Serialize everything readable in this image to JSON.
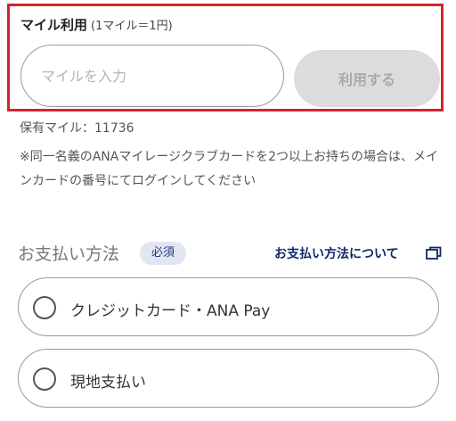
{
  "mileage": {
    "title": "マイル利用",
    "rate": "(1マイル＝1円)",
    "input_placeholder": "マイルを入力",
    "input_value": "",
    "use_button_label": "利用する",
    "held_miles": "保有マイル：11736",
    "note": "※同一名義のANAマイレージクラブカードを2つ以上お持ちの場合は、メインカードの番号にてログインしてください"
  },
  "payment": {
    "label": "お支払い方法",
    "required_badge": "必須",
    "about_link": "お支払い方法について",
    "options": [
      {
        "label": "クレジットカード・ANA Pay"
      },
      {
        "label": "現地支払い"
      }
    ]
  },
  "colors": {
    "highlight_border": "#d5232e",
    "link": "#0e2866",
    "badge_bg": "#e1e6f1",
    "disabled_button": "#dcdcdc"
  }
}
